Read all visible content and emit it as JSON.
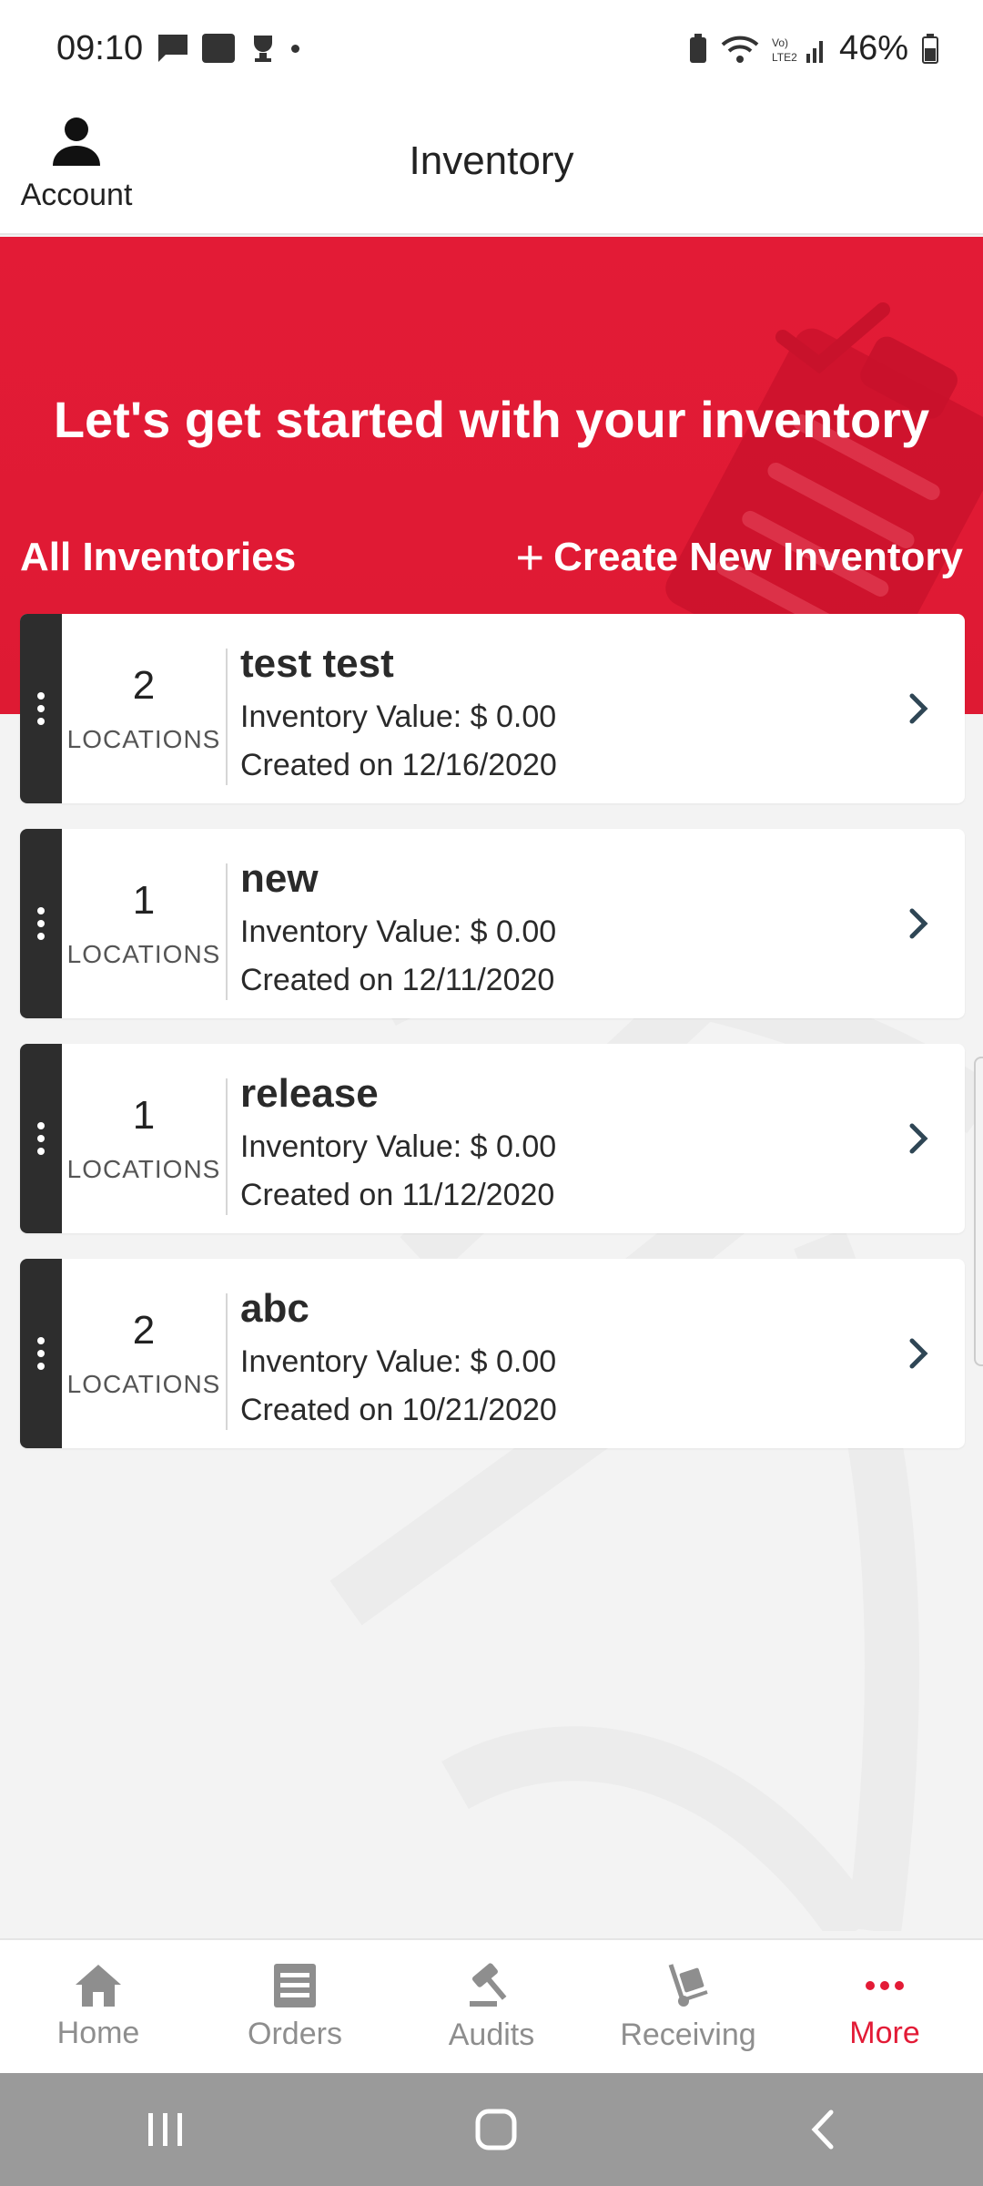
{
  "status_bar": {
    "time": "09:10",
    "battery": "46%"
  },
  "header": {
    "account_label": "Account",
    "title": "Inventory"
  },
  "hero": {
    "headline": "Let's get started with your inventory",
    "all_label": "All Inventories",
    "create_label": "Create New Inventory"
  },
  "inventories": [
    {
      "count": "2",
      "loc_label": "LOCATIONS",
      "name": "test test",
      "value": "Inventory Value: $ 0.00",
      "created": "Created on 12/16/2020"
    },
    {
      "count": "1",
      "loc_label": "LOCATIONS",
      "name": "new",
      "value": "Inventory Value: $ 0.00",
      "created": "Created on 12/11/2020"
    },
    {
      "count": "1",
      "loc_label": "LOCATIONS",
      "name": "release",
      "value": "Inventory Value: $ 0.00",
      "created": "Created on 11/12/2020"
    },
    {
      "count": "2",
      "loc_label": "LOCATIONS",
      "name": "abc",
      "value": "Inventory Value: $ 0.00",
      "created": "Created on 10/21/2020"
    }
  ],
  "bottom_nav": [
    {
      "label": "Home",
      "icon": "home-icon"
    },
    {
      "label": "Orders",
      "icon": "orders-icon"
    },
    {
      "label": "Audits",
      "icon": "gavel-icon"
    },
    {
      "label": "Receiving",
      "icon": "hand-truck-icon"
    },
    {
      "label": "More",
      "icon": "more-dots-icon",
      "active": true
    }
  ],
  "colors": {
    "brand_red": "#e31b36",
    "handle_dark": "#2d2d2d",
    "nav_inactive": "#8e8e8e"
  }
}
